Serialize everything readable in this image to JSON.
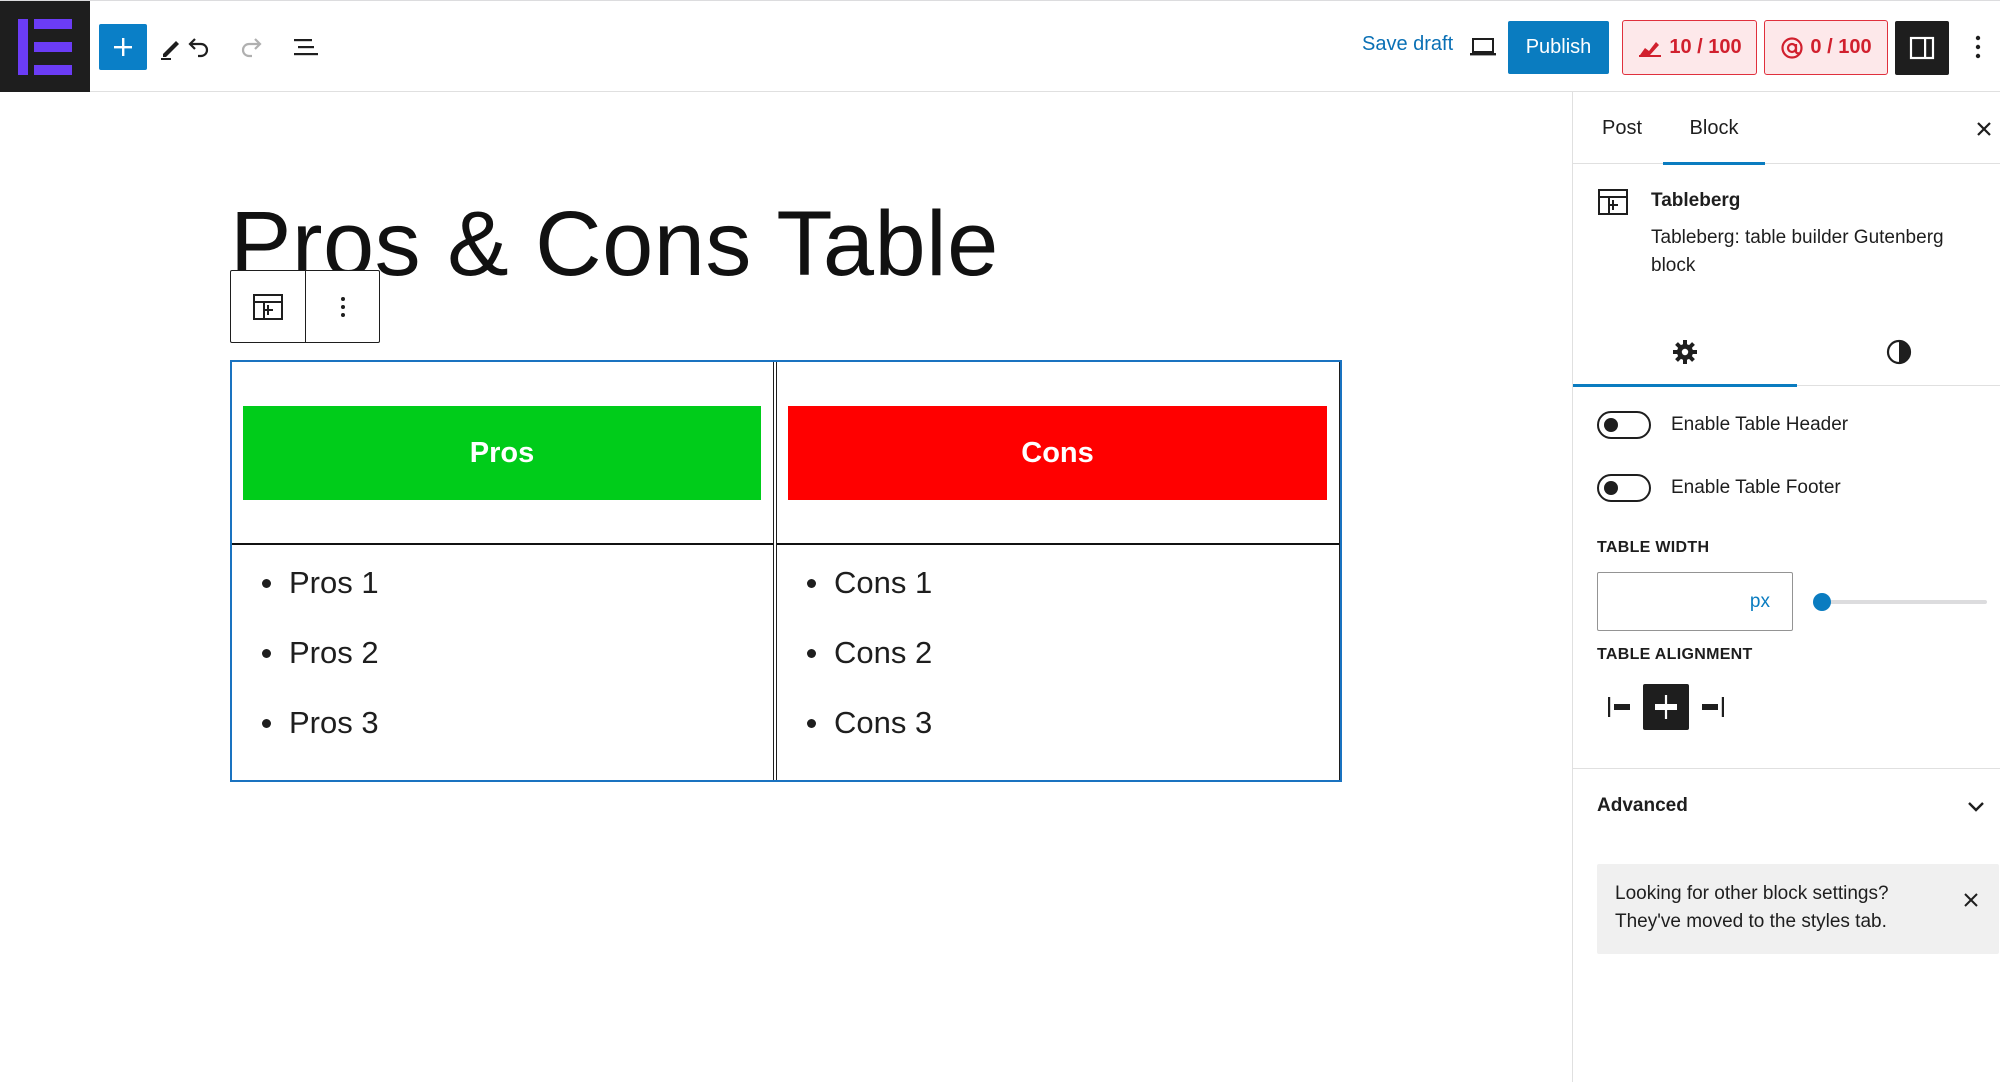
{
  "colors": {
    "accent": "#0a7cc0",
    "pros_header": "#00cc1a",
    "cons_header": "#ff0000",
    "score_alert": "#d1202e",
    "logo_purple": "#6b3cf5"
  },
  "topbar": {
    "logo_icon": "editor-logo-icon",
    "add_block_icon": "plus-icon",
    "tools_icon": "pencil-icon",
    "undo_icon": "undo-icon",
    "redo_icon": "redo-icon",
    "outline_icon": "list-view-icon",
    "save_draft_label": "Save draft",
    "preview_icon": "laptop-icon",
    "publish_label": "Publish",
    "seo_score": "10 / 100",
    "seo_icon": "seo-score-icon",
    "readability_score": "0 / 100",
    "readability_icon": "readability-score-icon",
    "settings_icon": "sidebar-toggle-icon",
    "options_icon": "vertical-ellipsis-icon"
  },
  "editor": {
    "post_title": "Pros & Cons Table",
    "block_toolbar": {
      "block_icon": "table-icon",
      "options_icon": "vertical-ellipsis-icon"
    },
    "table": {
      "pros": {
        "header": "Pros",
        "items": [
          "Pros 1",
          "Pros 2",
          "Pros 3"
        ]
      },
      "cons": {
        "header": "Cons",
        "items": [
          "Cons 1",
          "Cons 2",
          "Cons 3"
        ]
      }
    }
  },
  "sidebar": {
    "tabs": [
      {
        "label": "Post",
        "active": false
      },
      {
        "label": "Block",
        "active": true
      }
    ],
    "close_icon": "close-icon",
    "block_card": {
      "icon": "table-icon",
      "title": "Tableberg",
      "description": "Tableberg: table builder Gutenberg block"
    },
    "sub_tabs": [
      {
        "icon": "gear-icon",
        "active": true
      },
      {
        "icon": "contrast-icon",
        "active": false
      }
    ],
    "toggles": [
      {
        "label": "Enable Table Header",
        "checked": false
      },
      {
        "label": "Enable Table Footer",
        "checked": false
      }
    ],
    "table_width": {
      "label": "TABLE WIDTH",
      "value": "",
      "unit": "px",
      "slider_value": 0
    },
    "table_alignment": {
      "label": "TABLE ALIGNMENT",
      "options": [
        {
          "icon": "align-left-icon",
          "active": false
        },
        {
          "icon": "align-center-icon",
          "active": true
        },
        {
          "icon": "align-right-icon",
          "active": false
        }
      ]
    },
    "advanced": {
      "label": "Advanced",
      "icon": "chevron-down-icon"
    },
    "notice": {
      "text": "Looking for other block settings? They've moved to the styles tab.",
      "close_icon": "close-icon"
    }
  }
}
